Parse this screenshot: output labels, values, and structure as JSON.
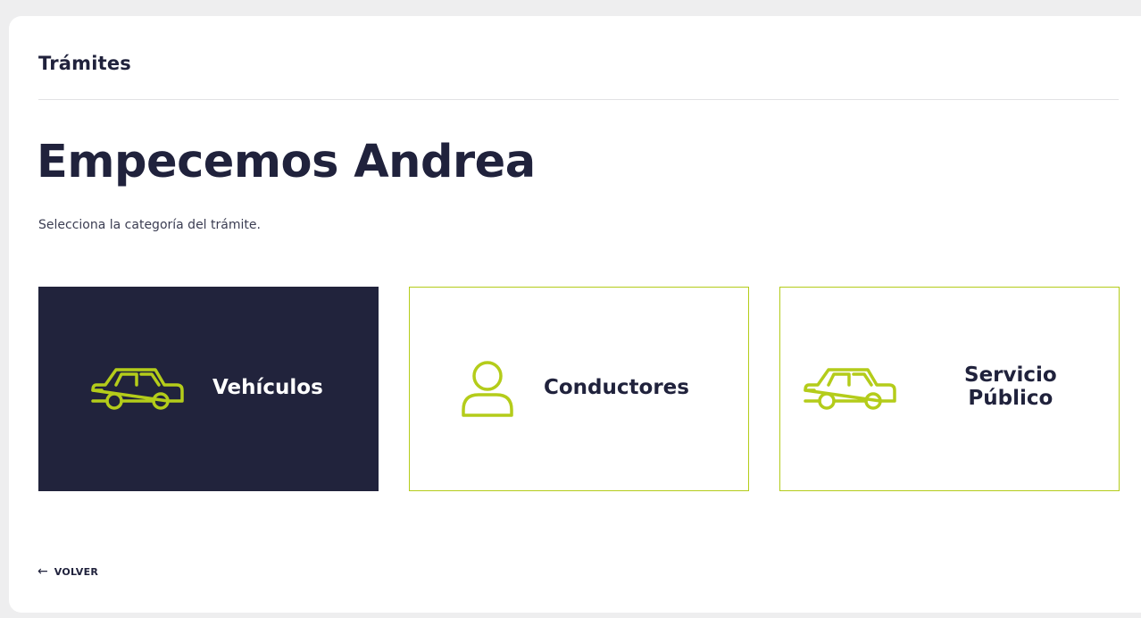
{
  "header": {
    "title": "Trámites"
  },
  "main": {
    "greeting": "Empecemos Andrea",
    "instruction": "Selecciona la categoría del trámite."
  },
  "categories": [
    {
      "label": "Vehículos",
      "icon": "car-icon",
      "selected": true
    },
    {
      "label": "Conductores",
      "icon": "person-icon",
      "selected": false
    },
    {
      "label_line1": "Servicio",
      "label_line2": "Público",
      "icon": "car-icon",
      "selected": false
    }
  ],
  "footer": {
    "back_label": "VOLVER",
    "back_icon": "arrow-left-icon"
  },
  "colors": {
    "navy": "#21233c",
    "accent_lime": "#b4cc1a",
    "background": "#eeeeef"
  }
}
